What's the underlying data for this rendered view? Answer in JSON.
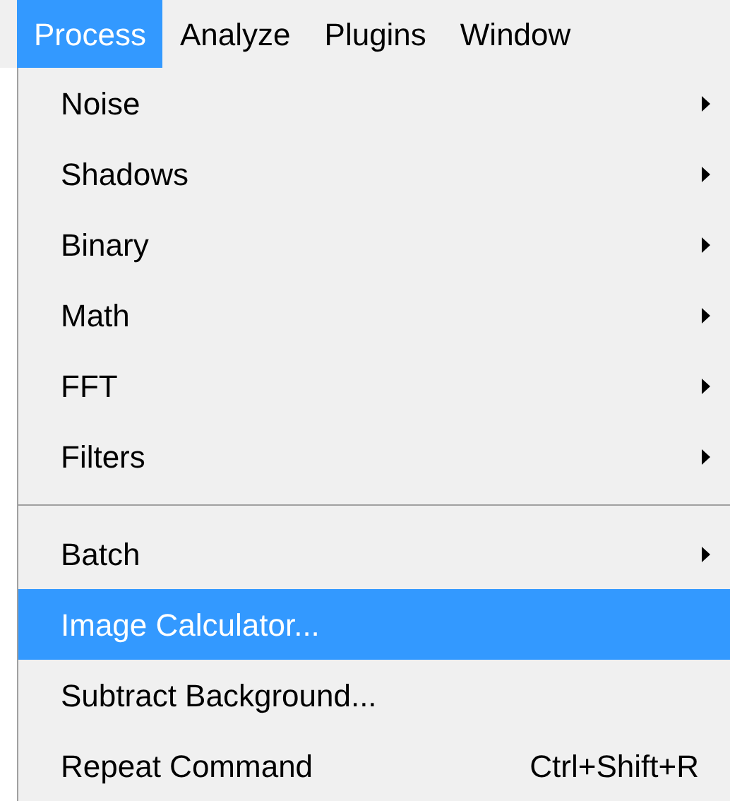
{
  "menubar": [
    {
      "label": "Process",
      "selected": true
    },
    {
      "label": "Analyze",
      "selected": false
    },
    {
      "label": "Plugins",
      "selected": false
    },
    {
      "label": "Window",
      "selected": false
    }
  ],
  "menu": {
    "items": [
      {
        "kind": "submenu",
        "label": "Noise",
        "selected": false
      },
      {
        "kind": "submenu",
        "label": "Shadows",
        "selected": false
      },
      {
        "kind": "submenu",
        "label": "Binary",
        "selected": false
      },
      {
        "kind": "submenu",
        "label": "Math",
        "selected": false
      },
      {
        "kind": "submenu",
        "label": "FFT",
        "selected": false
      },
      {
        "kind": "submenu",
        "label": "Filters",
        "selected": false
      },
      {
        "kind": "separator"
      },
      {
        "kind": "submenu",
        "label": "Batch",
        "selected": false
      },
      {
        "kind": "command",
        "label": "Image Calculator...",
        "selected": true
      },
      {
        "kind": "command",
        "label": "Subtract Background...",
        "selected": false
      },
      {
        "kind": "command",
        "label": "Repeat Command",
        "shortcut": "Ctrl+Shift+R",
        "selected": false
      }
    ]
  }
}
